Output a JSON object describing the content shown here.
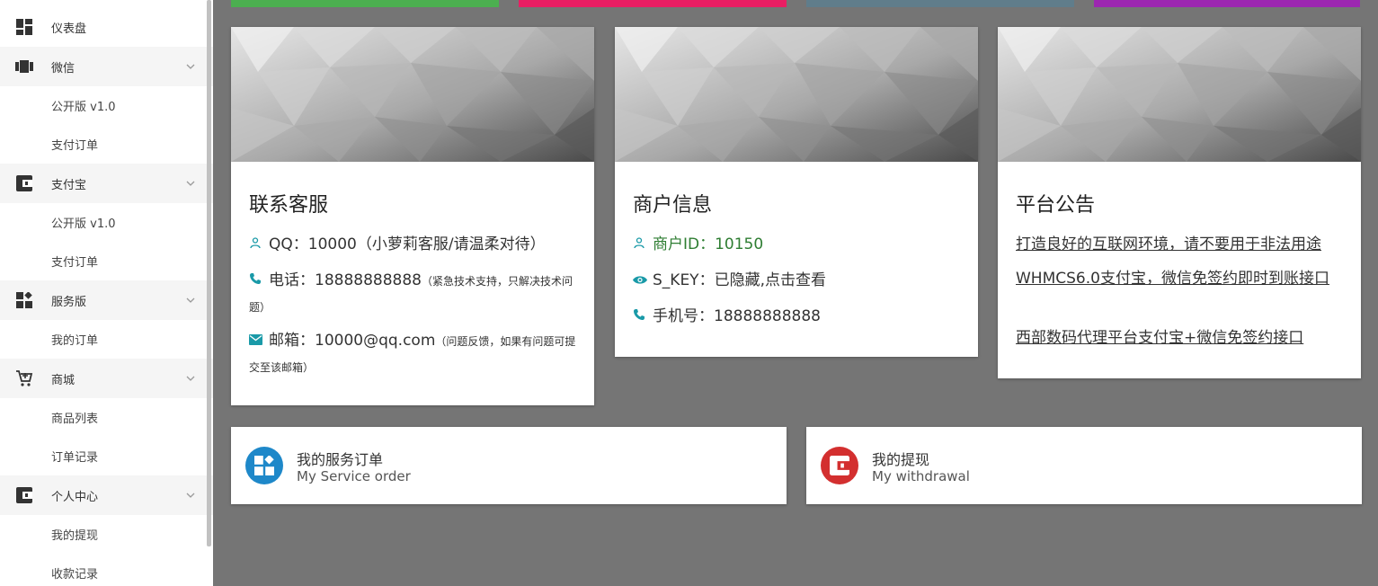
{
  "sidebar": {
    "groups": [
      {
        "label": "仪表盘",
        "icon": "dashboard-icon",
        "items": []
      },
      {
        "label": "微信",
        "icon": "wechat-icon",
        "items": [
          "公开版 v1.0",
          "支付订单"
        ]
      },
      {
        "label": "支付宝",
        "icon": "wallet-icon",
        "items": [
          "公开版 v1.0",
          "支付订单"
        ]
      },
      {
        "label": "服务版",
        "icon": "widgets-icon",
        "items": [
          "我的订单"
        ]
      },
      {
        "label": "商城",
        "icon": "cart-icon",
        "items": [
          "商品列表",
          "订单记录"
        ]
      },
      {
        "label": "个人中心",
        "icon": "wallet-icon",
        "items": [
          "我的提现",
          "收款记录"
        ]
      }
    ]
  },
  "strip_colors": [
    "#4caf50",
    "#e91e63",
    "#607d8b",
    "#9c27b0"
  ],
  "contact": {
    "title": "联系客服",
    "qq": "QQ：10000（小萝莉客服/请温柔对待）",
    "phone_main": "电话：18888888888",
    "phone_note": "（紧急技术支持，只解决技术问题）",
    "email_main": "邮箱：10000@qq.com",
    "email_note": "（问题反馈，如果有问题可提交至该邮箱）"
  },
  "merchant": {
    "title": "商户信息",
    "id": "商户ID：10150",
    "skey": "S_KEY：已隐藏,点击查看",
    "mobile": "手机号：18888888888"
  },
  "notice": {
    "title": "平台公告",
    "links": [
      "打造良好的互联网环境，请不要用于非法用途",
      "WHMCS6.0支付宝，微信免签约即时到账接口",
      "西部数码代理平台支付宝+微信免签约接口"
    ]
  },
  "buttons": {
    "service": {
      "title": "我的服务订单",
      "sub": "My Service order",
      "color": "#1e88c9"
    },
    "withdraw": {
      "title": "我的提现",
      "sub": "My withdrawal",
      "color": "#d32f2f"
    }
  },
  "accent": "#1a9aa8"
}
